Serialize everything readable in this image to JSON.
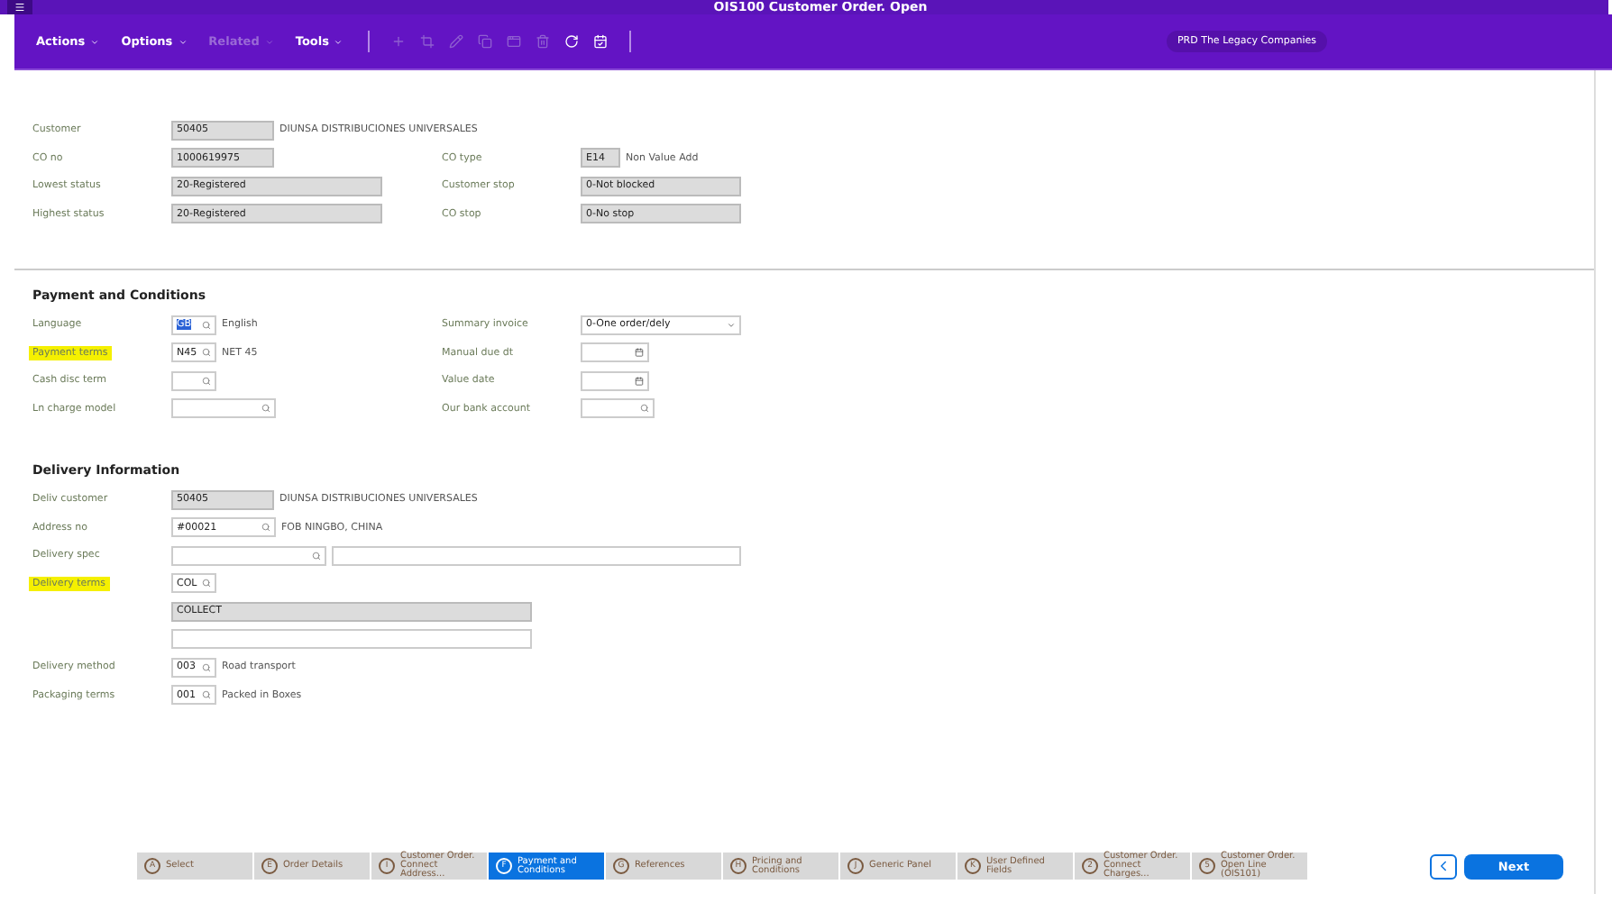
{
  "window": {
    "title": "OIS100 Customer Order. Open"
  },
  "toolbar": {
    "menus": [
      {
        "label": "Actions",
        "disabled": false
      },
      {
        "label": "Options",
        "disabled": false
      },
      {
        "label": "Related",
        "disabled": true
      },
      {
        "label": "Tools",
        "disabled": false
      }
    ],
    "tools": [
      {
        "kind": "add",
        "disabled": true
      },
      {
        "kind": "crop",
        "disabled": true
      },
      {
        "kind": "edit",
        "disabled": true
      },
      {
        "kind": "copy",
        "disabled": true
      },
      {
        "kind": "window",
        "disabled": true
      },
      {
        "kind": "delete",
        "disabled": true
      },
      {
        "kind": "refresh",
        "disabled": false
      },
      {
        "kind": "save",
        "disabled": false
      }
    ],
    "environment": "PRD The Legacy Companies"
  },
  "sections": [
    {
      "rows": [
        {
          "left": {
            "label": "Customer",
            "kind": "readonly",
            "value": "50405",
            "description": "DIUNSA DISTRIBUCIONES UNIVERSALES"
          }
        },
        {
          "left": {
            "label": "CO no",
            "kind": "readonly",
            "value": "1000619975"
          },
          "right": {
            "label": "CO type",
            "kind": "readonly",
            "value": "E14",
            "description": "Non Value Add"
          }
        },
        {
          "left": {
            "label": "Lowest status",
            "kind": "readonly",
            "value": "20-Registered"
          },
          "right": {
            "label": "Customer stop",
            "kind": "readonly",
            "value": "0-Not blocked"
          }
        },
        {
          "left": {
            "label": "Highest status",
            "kind": "readonly",
            "value": "20-Registered"
          },
          "right": {
            "label": "CO stop",
            "kind": "readonly",
            "value": "0-No stop"
          }
        }
      ]
    },
    {
      "title": "Payment and Conditions",
      "rows": [
        {
          "left": {
            "label": "Language",
            "kind": "lookup",
            "value": "GB",
            "text_selected": true,
            "description": "English"
          },
          "right": {
            "label": "Summary invoice",
            "kind": "dropdown",
            "value": "0-One order/dely"
          }
        },
        {
          "left": {
            "label": "Payment terms",
            "kind": "lookup",
            "value": "N45",
            "description": "NET 45",
            "highlighted": true
          },
          "right": {
            "label": "Manual due dt",
            "kind": "date"
          }
        },
        {
          "left": {
            "label": "Cash disc term",
            "kind": "lookup"
          },
          "right": {
            "label": "Value date",
            "kind": "date"
          }
        },
        {
          "left": {
            "label": "Ln charge model",
            "kind": "lookup"
          },
          "right": {
            "label": "Our bank account",
            "kind": "lookup"
          }
        }
      ]
    },
    {
      "title": "Delivery Information",
      "rows": [
        {
          "left": {
            "label": "Deliv customer",
            "kind": "readonly",
            "value": "50405",
            "description": "DIUNSA DISTRIBUCIONES UNIVERSALES"
          }
        },
        {
          "left": {
            "label": "Address no",
            "kind": "lookup",
            "value": "#00021",
            "description": "FOB NINGBO, CHINA"
          }
        },
        {
          "left": {
            "label": "Delivery spec",
            "kind": "lookup",
            "has_text_box": true
          }
        },
        {
          "left": {
            "label": "Delivery terms",
            "kind": "lookup",
            "value": "COL",
            "highlighted": true
          }
        },
        {
          "left": {
            "kind": "readonly",
            "value": "COLLECT"
          }
        },
        {
          "left": {
            "kind": "text"
          }
        },
        {
          "left": {
            "label": "Delivery method",
            "kind": "lookup",
            "value": "003",
            "description": "Road transport"
          }
        },
        {
          "left": {
            "label": "Packaging terms",
            "kind": "lookup",
            "value": "001",
            "description": "Packed in Boxes"
          }
        }
      ]
    }
  ],
  "steps": [
    {
      "letter": "A",
      "label": "Select",
      "selected": false
    },
    {
      "letter": "E",
      "label": "Order Details",
      "selected": false
    },
    {
      "letter": "I",
      "label": "Customer Order. Connect Address...",
      "selected": false
    },
    {
      "letter": "F",
      "label": "Payment and Conditions",
      "selected": true
    },
    {
      "letter": "G",
      "label": "References",
      "selected": false
    },
    {
      "letter": "H",
      "label": "Pricing and Conditions",
      "selected": false
    },
    {
      "letter": "J",
      "label": "Generic Panel",
      "selected": false
    },
    {
      "letter": "K",
      "label": "User Defined Fields",
      "selected": false
    },
    {
      "letter": "2",
      "label": "Customer Order. Connect Charges...",
      "selected": false
    },
    {
      "letter": "5",
      "label": "Customer Order. Open Line (OIS101)",
      "selected": false
    }
  ],
  "next_button": "Next"
}
